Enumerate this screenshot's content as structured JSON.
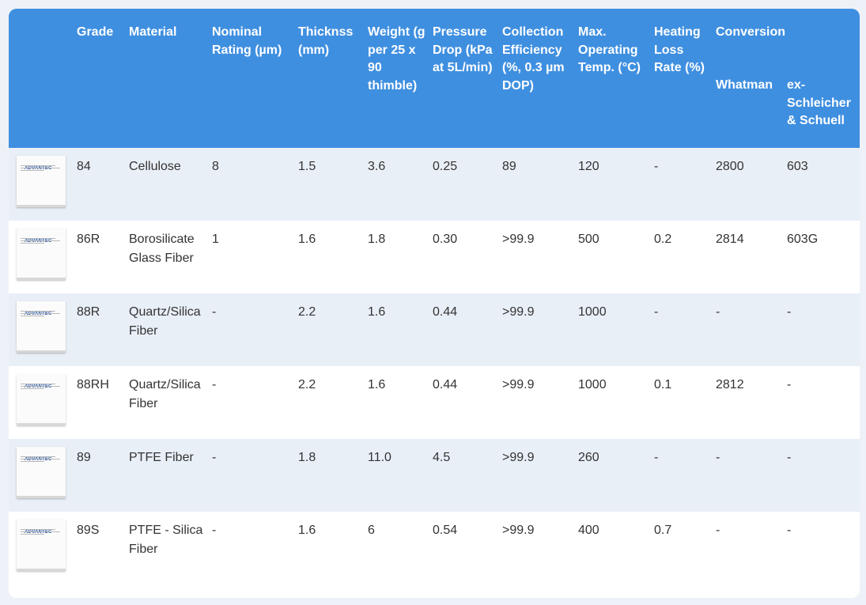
{
  "header": {
    "grade": "Grade",
    "material": "Material",
    "nominal_rating": "Nominal Rating (µm)",
    "thickness": "Thicknss (mm)",
    "weight": "Weight (g per 25 x 90 thimble)",
    "pressure_drop": "Pressure Drop (kPa at 5L/min)",
    "collection_efficiency": "Collection Efficiency (%, 0.3 µm DOP)",
    "max_temp": "Max. Operating Temp. (°C)",
    "heating_loss": "Heating Loss Rate (%)",
    "conversion": "Conversion",
    "whatman": "Whatman",
    "schleicher": "ex-Schleicher & Schuell"
  },
  "thumb_logo": "ADVANTEC",
  "rows": [
    {
      "grade": "84",
      "material": "Cellulose",
      "nominal": "8",
      "thickness": "1.5",
      "weight": "3.6",
      "pressure": "0.25",
      "efficiency": "89",
      "temp": "120",
      "heating": "-",
      "whatman": "2800",
      "schleicher": "603"
    },
    {
      "grade": "86R",
      "material": "Borosilicate Glass Fiber",
      "nominal": "1",
      "thickness": "1.6",
      "weight": "1.8",
      "pressure": "0.30",
      "efficiency": ">99.9",
      "temp": "500",
      "heating": "0.2",
      "whatman": "2814",
      "schleicher": "603G"
    },
    {
      "grade": "88R",
      "material": "Quartz/Silica Fiber",
      "nominal": "-",
      "thickness": "2.2",
      "weight": "1.6",
      "pressure": "0.44",
      "efficiency": ">99.9",
      "temp": "1000",
      "heating": "-",
      "whatman": "-",
      "schleicher": "-"
    },
    {
      "grade": "88RH",
      "material": "Quartz/Silica Fiber",
      "nominal": "-",
      "thickness": "2.2",
      "weight": "1.6",
      "pressure": "0.44",
      "efficiency": ">99.9",
      "temp": "1000",
      "heating": "0.1",
      "whatman": "2812",
      "schleicher": "-"
    },
    {
      "grade": "89",
      "material": "PTFE Fiber",
      "nominal": "-",
      "thickness": "1.8",
      "weight": "11.0",
      "pressure": "4.5",
      "efficiency": ">99.9",
      "temp": "260",
      "heating": "-",
      "whatman": "-",
      "schleicher": "-"
    },
    {
      "grade": "89S",
      "material": "PTFE - Silica Fiber",
      "nominal": "-",
      "thickness": "1.6",
      "weight": "6",
      "pressure": "0.54",
      "efficiency": ">99.9",
      "temp": "400",
      "heating": "0.7",
      "whatman": "-",
      "schleicher": "-"
    }
  ]
}
